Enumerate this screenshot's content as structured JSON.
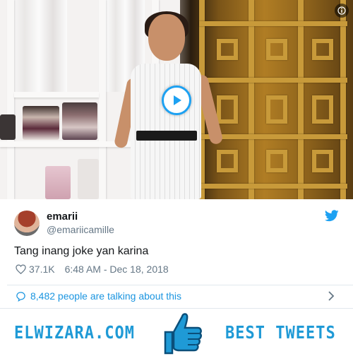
{
  "media": {
    "play_icon": "play-icon",
    "info_icon": "info-icon"
  },
  "tweet": {
    "display_name": "emarii",
    "handle": "@emariicamille",
    "text": "Tang inang joke yan karina",
    "likes": "37.1K",
    "timestamp": "6:48 AM - Dec 18, 2018",
    "talking": "8,482 people are talking about this"
  },
  "banner": {
    "site": "ELWIZARA.COM",
    "tagline": "BEST TWEETS"
  },
  "colors": {
    "accent": "#1da1f2",
    "link": "#1b95e0",
    "banner": "#1f9ad6"
  }
}
